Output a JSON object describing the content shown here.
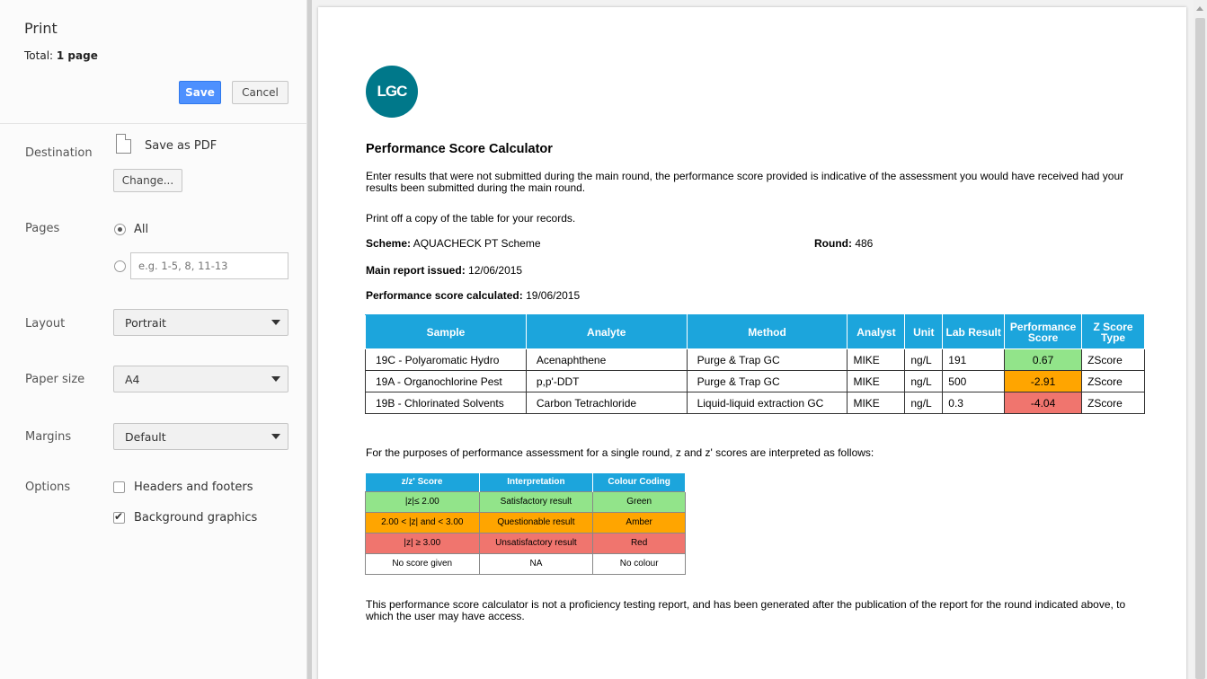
{
  "print_panel": {
    "title": "Print",
    "total_label": "Total:",
    "total_value": "1 page",
    "save_label": "Save",
    "cancel_label": "Cancel",
    "destination": {
      "label": "Destination",
      "value": "Save as PDF",
      "change_label": "Change..."
    },
    "pages": {
      "label": "Pages",
      "all_label": "All",
      "range_placeholder": "e.g. 1-5, 8, 11-13"
    },
    "layout": {
      "label": "Layout",
      "value": "Portrait"
    },
    "paper_size": {
      "label": "Paper size",
      "value": "A4"
    },
    "margins": {
      "label": "Margins",
      "value": "Default"
    },
    "options": {
      "label": "Options",
      "headers_footers": "Headers and footers",
      "background_graphics": "Background graphics"
    }
  },
  "document": {
    "logo_text": "LGC",
    "title": "Performance Score Calculator",
    "intro": "Enter results that were not submitted during the main round, the performance score provided is indicative of the assessment you would have received had your results been submitted during the main round.",
    "print_note": "Print off a copy of the table for your records.",
    "scheme_label": "Scheme:",
    "scheme_value": "AQUACHECK PT Scheme",
    "round_label": "Round:",
    "round_value": "486",
    "issued_label": "Main report issued:",
    "issued_value": "12/06/2015",
    "calculated_label": "Performance score calculated:",
    "calculated_value": "19/06/2015",
    "results_table": {
      "headers": [
        "Sample",
        "Analyte",
        "Method",
        "Analyst",
        "Unit",
        "Lab Result",
        "Performance Score",
        "Z Score Type"
      ],
      "rows": [
        {
          "sample": "19C - Polyaromatic Hydro",
          "analyte": "Acenaphthene",
          "method": "Purge & Trap GC",
          "analyst": "MIKE",
          "unit": "ng/L",
          "result": "191",
          "score": "0.67",
          "score_color": "#92e48a",
          "type": "ZScore"
        },
        {
          "sample": "19A - Organochlorine Pest",
          "analyte": "p,p'-DDT",
          "method": "Purge & Trap GC",
          "analyst": "MIKE",
          "unit": "ng/L",
          "result": "500",
          "score": "-2.91",
          "score_color": "#ffa500",
          "type": "ZScore"
        },
        {
          "sample": "19B - Chlorinated Solvents",
          "analyte": "Carbon Tetrachloride",
          "method": "Liquid-liquid extraction GC",
          "analyst": "MIKE",
          "unit": "ng/L",
          "result": "0.3",
          "score": "-4.04",
          "score_color": "#f0756e",
          "type": "ZScore"
        }
      ]
    },
    "interpretation_note": "For the purposes of performance assessment for a single round, z and z' scores are interpreted as follows:",
    "legend_table": {
      "headers": [
        "z/z' Score",
        "Interpretation",
        "Colour Coding"
      ],
      "rows": [
        {
          "score": "|z|≤ 2.00",
          "interpretation": "Satisfactory result",
          "colour": "Green",
          "bg": "#92e48a"
        },
        {
          "score": "2.00 < |z| and < 3.00",
          "interpretation": "Questionable result",
          "colour": "Amber",
          "bg": "#ffa500"
        },
        {
          "score": "|z| ≥ 3.00",
          "interpretation": "Unsatisfactory result",
          "colour": "Red",
          "bg": "#f0756e"
        },
        {
          "score": "No score given",
          "interpretation": "NA",
          "colour": "No colour",
          "bg": "#ffffff"
        }
      ]
    },
    "footer": "This performance score calculator is not a proficiency testing report, and has been generated after the publication of the report for the round indicated above, to which the user may have access."
  }
}
